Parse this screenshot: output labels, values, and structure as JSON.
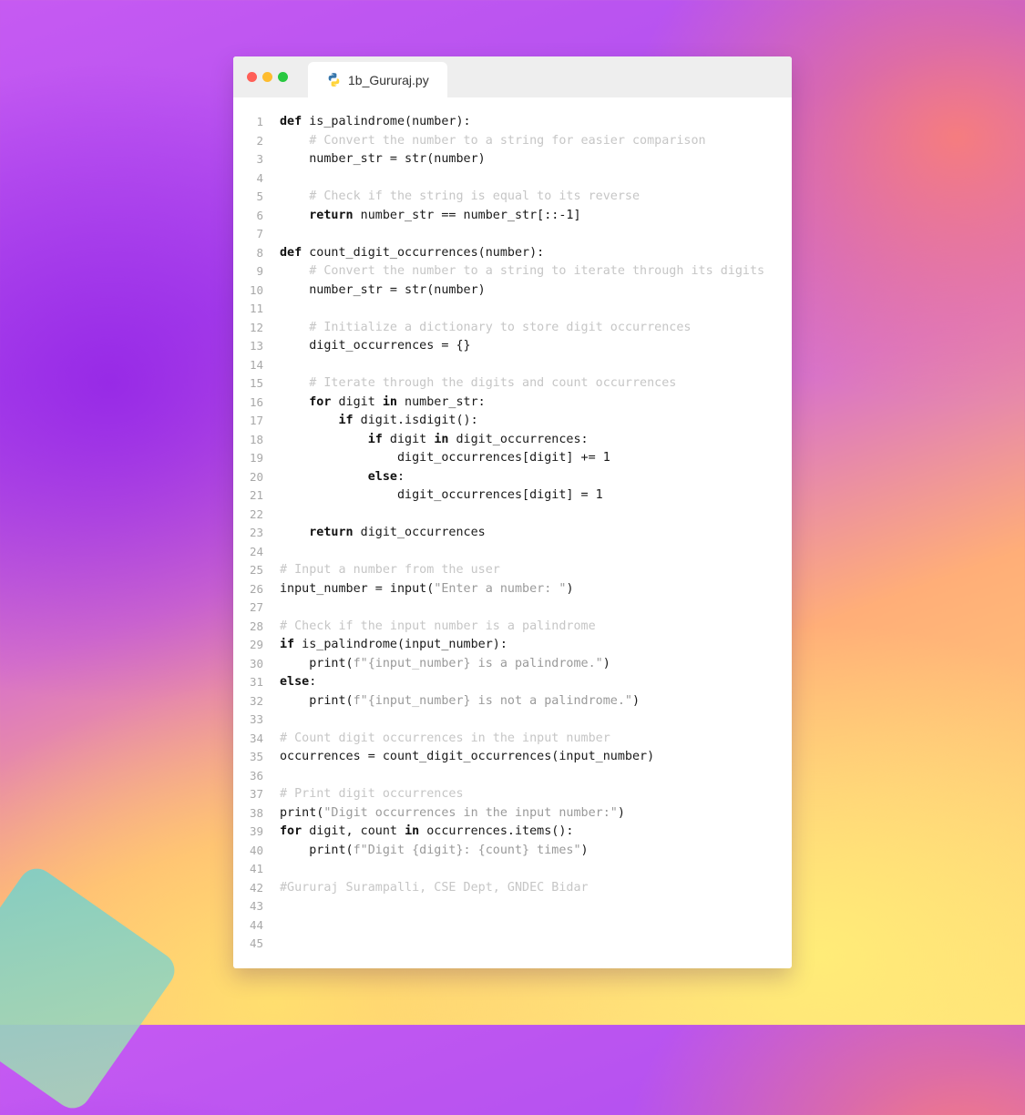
{
  "window": {
    "tab_title": "1b_Gururaj.py",
    "tab_icon": "python-icon",
    "traffic_lights": {
      "close": "#ff5f57",
      "minimize": "#febc2e",
      "maximize": "#28c840"
    }
  },
  "code": {
    "language": "python",
    "lines": [
      {
        "n": "1",
        "tokens": [
          [
            "kw",
            "def"
          ],
          [
            "p",
            " is_palindrome(number):"
          ]
        ]
      },
      {
        "n": "2",
        "tokens": [
          [
            "p",
            "    "
          ],
          [
            "cm",
            "# Convert the number to a string for easier comparison"
          ]
        ]
      },
      {
        "n": "3",
        "tokens": [
          [
            "p",
            "    number_str = str(number)"
          ]
        ]
      },
      {
        "n": "4",
        "tokens": []
      },
      {
        "n": "5",
        "tokens": [
          [
            "p",
            "    "
          ],
          [
            "cm",
            "# Check if the string is equal to its reverse"
          ]
        ]
      },
      {
        "n": "6",
        "tokens": [
          [
            "p",
            "    "
          ],
          [
            "kw",
            "return"
          ],
          [
            "p",
            " number_str == number_str[::-1]"
          ]
        ]
      },
      {
        "n": "7",
        "tokens": []
      },
      {
        "n": "8",
        "tokens": [
          [
            "kw",
            "def"
          ],
          [
            "p",
            " count_digit_occurrences(number):"
          ]
        ]
      },
      {
        "n": "9",
        "tokens": [
          [
            "p",
            "    "
          ],
          [
            "cm",
            "# Convert the number to a string to iterate through its digits"
          ]
        ]
      },
      {
        "n": "10",
        "tokens": [
          [
            "p",
            "    number_str = str(number)"
          ]
        ]
      },
      {
        "n": "11",
        "tokens": []
      },
      {
        "n": "12",
        "tokens": [
          [
            "p",
            "    "
          ],
          [
            "cm",
            "# Initialize a dictionary to store digit occurrences"
          ]
        ]
      },
      {
        "n": "13",
        "tokens": [
          [
            "p",
            "    digit_occurrences = {}"
          ]
        ]
      },
      {
        "n": "14",
        "tokens": []
      },
      {
        "n": "15",
        "tokens": [
          [
            "p",
            "    "
          ],
          [
            "cm",
            "# Iterate through the digits and count occurrences"
          ]
        ]
      },
      {
        "n": "16",
        "tokens": [
          [
            "p",
            "    "
          ],
          [
            "kw",
            "for"
          ],
          [
            "p",
            " digit "
          ],
          [
            "kw",
            "in"
          ],
          [
            "p",
            " number_str:"
          ]
        ]
      },
      {
        "n": "17",
        "tokens": [
          [
            "p",
            "        "
          ],
          [
            "kw",
            "if"
          ],
          [
            "p",
            " digit.isdigit():"
          ]
        ]
      },
      {
        "n": "18",
        "tokens": [
          [
            "p",
            "            "
          ],
          [
            "kw",
            "if"
          ],
          [
            "p",
            " digit "
          ],
          [
            "kw",
            "in"
          ],
          [
            "p",
            " digit_occurrences:"
          ]
        ]
      },
      {
        "n": "19",
        "tokens": [
          [
            "p",
            "                digit_occurrences[digit] += 1"
          ]
        ]
      },
      {
        "n": "20",
        "tokens": [
          [
            "p",
            "            "
          ],
          [
            "kw",
            "else"
          ],
          [
            "p",
            ":"
          ]
        ]
      },
      {
        "n": "21",
        "tokens": [
          [
            "p",
            "                digit_occurrences[digit] = 1"
          ]
        ]
      },
      {
        "n": "22",
        "tokens": []
      },
      {
        "n": "23",
        "tokens": [
          [
            "p",
            "    "
          ],
          [
            "kw",
            "return"
          ],
          [
            "p",
            " digit_occurrences"
          ]
        ]
      },
      {
        "n": "24",
        "tokens": []
      },
      {
        "n": "25",
        "tokens": [
          [
            "cm",
            "# Input a number from the user"
          ]
        ]
      },
      {
        "n": "26",
        "tokens": [
          [
            "p",
            "input_number = input("
          ],
          [
            "str",
            "\"Enter a number: \""
          ],
          [
            "p",
            ")"
          ]
        ]
      },
      {
        "n": "27",
        "tokens": []
      },
      {
        "n": "28",
        "tokens": [
          [
            "cm",
            "# Check if the input number is a palindrome"
          ]
        ]
      },
      {
        "n": "29",
        "tokens": [
          [
            "kw",
            "if"
          ],
          [
            "p",
            " is_palindrome(input_number):"
          ]
        ]
      },
      {
        "n": "30",
        "tokens": [
          [
            "p",
            "    print("
          ],
          [
            "str",
            "f\"{input_number} is a palindrome.\""
          ],
          [
            "p",
            ")"
          ]
        ]
      },
      {
        "n": "31",
        "tokens": [
          [
            "kw",
            "else"
          ],
          [
            "p",
            ":"
          ]
        ]
      },
      {
        "n": "32",
        "tokens": [
          [
            "p",
            "    print("
          ],
          [
            "str",
            "f\"{input_number} is not a palindrome.\""
          ],
          [
            "p",
            ")"
          ]
        ]
      },
      {
        "n": "33",
        "tokens": []
      },
      {
        "n": "34",
        "tokens": [
          [
            "cm",
            "# Count digit occurrences in the input number"
          ]
        ]
      },
      {
        "n": "35",
        "tokens": [
          [
            "p",
            "occurrences = count_digit_occurrences(input_number)"
          ]
        ]
      },
      {
        "n": "36",
        "tokens": []
      },
      {
        "n": "37",
        "tokens": [
          [
            "cm",
            "# Print digit occurrences"
          ]
        ]
      },
      {
        "n": "38",
        "tokens": [
          [
            "p",
            "print("
          ],
          [
            "str",
            "\"Digit occurrences in the input number:\""
          ],
          [
            "p",
            ")"
          ]
        ]
      },
      {
        "n": "39",
        "tokens": [
          [
            "kw",
            "for"
          ],
          [
            "p",
            " digit, count "
          ],
          [
            "kw",
            "in"
          ],
          [
            "p",
            " occurrences.items():"
          ]
        ]
      },
      {
        "n": "40",
        "tokens": [
          [
            "p",
            "    print("
          ],
          [
            "str",
            "f\"Digit {digit}: {count} times\""
          ],
          [
            "p",
            ")"
          ]
        ]
      },
      {
        "n": "41",
        "tokens": []
      },
      {
        "n": "42",
        "tokens": [
          [
            "cm",
            "#Gururaj Surampalli, CSE Dept, GNDEC Bidar"
          ]
        ]
      },
      {
        "n": "43",
        "tokens": []
      },
      {
        "n": "44",
        "tokens": []
      },
      {
        "n": "45",
        "tokens": []
      }
    ]
  }
}
